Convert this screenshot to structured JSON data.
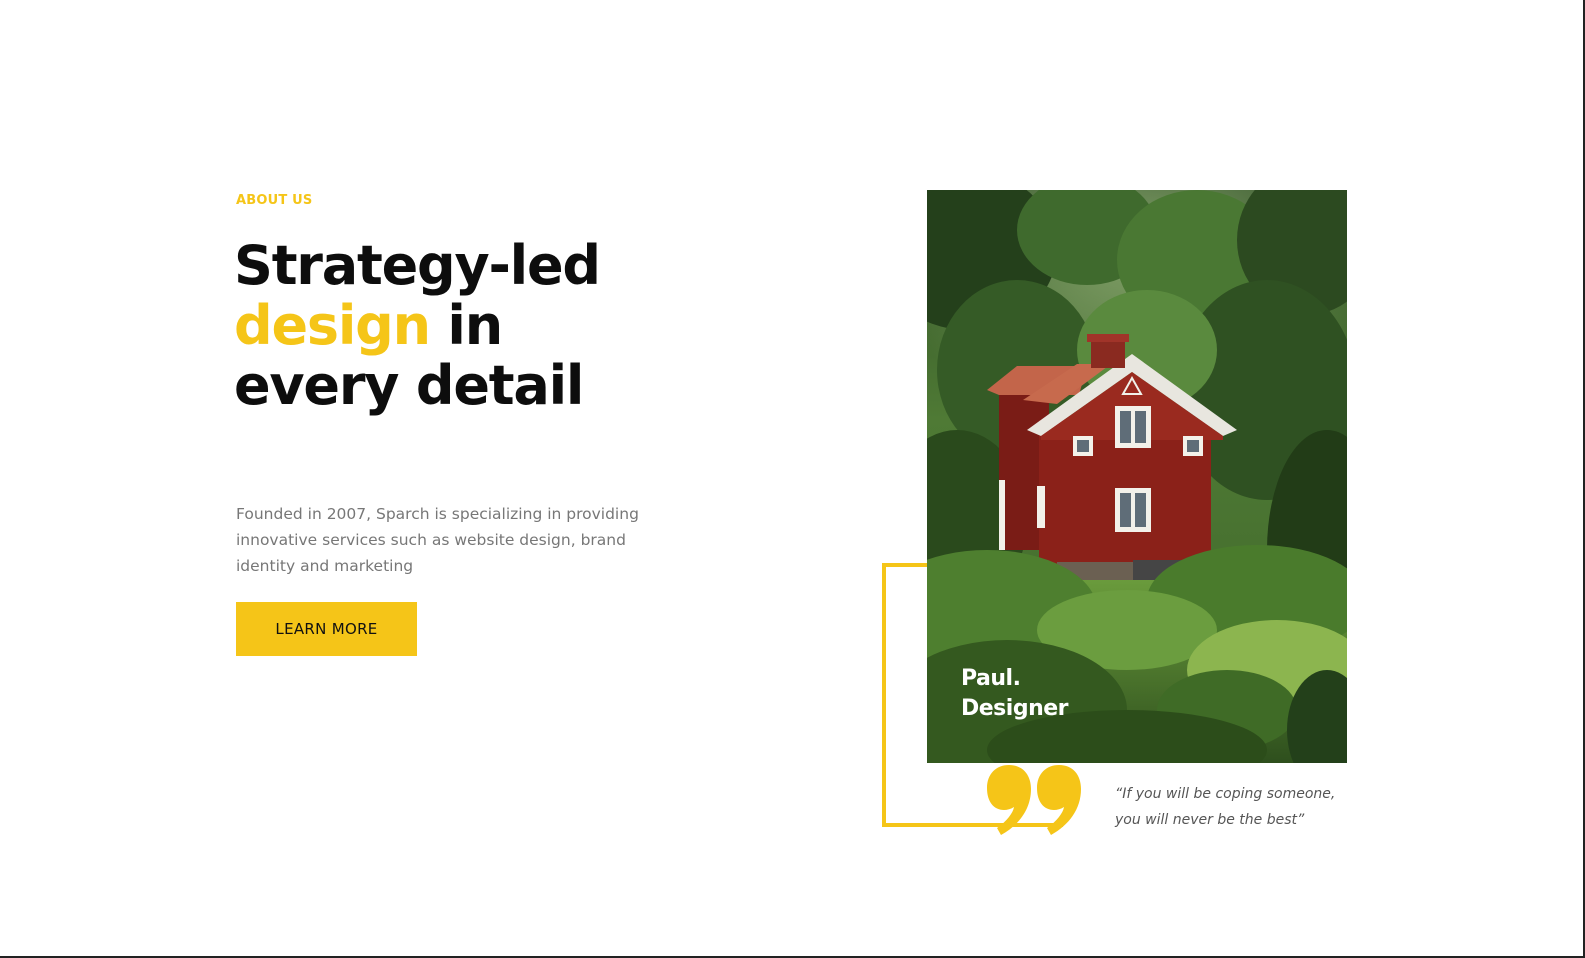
{
  "about": {
    "eyebrow": "ABOUT US",
    "headline_line1": "Strategy-led",
    "headline_accent": "design",
    "headline_line2_rest": " in",
    "headline_line3": "every detail",
    "description": "Founded in 2007, Sparch is specializing in providing innovative services such as website design, brand identity and marketing",
    "cta_label": "LEARN MORE"
  },
  "feature": {
    "image_subject": "red-house-in-forest",
    "caption_name": "Paul.",
    "caption_role": "Designer",
    "quote": "“If you will be coping someone, you will never be the best”",
    "quote_icon": "closing-quote-icon"
  },
  "colors": {
    "accent": "#f5c518",
    "heading": "#0d0d0d",
    "body_text": "#777777",
    "quote_text": "#555555"
  }
}
